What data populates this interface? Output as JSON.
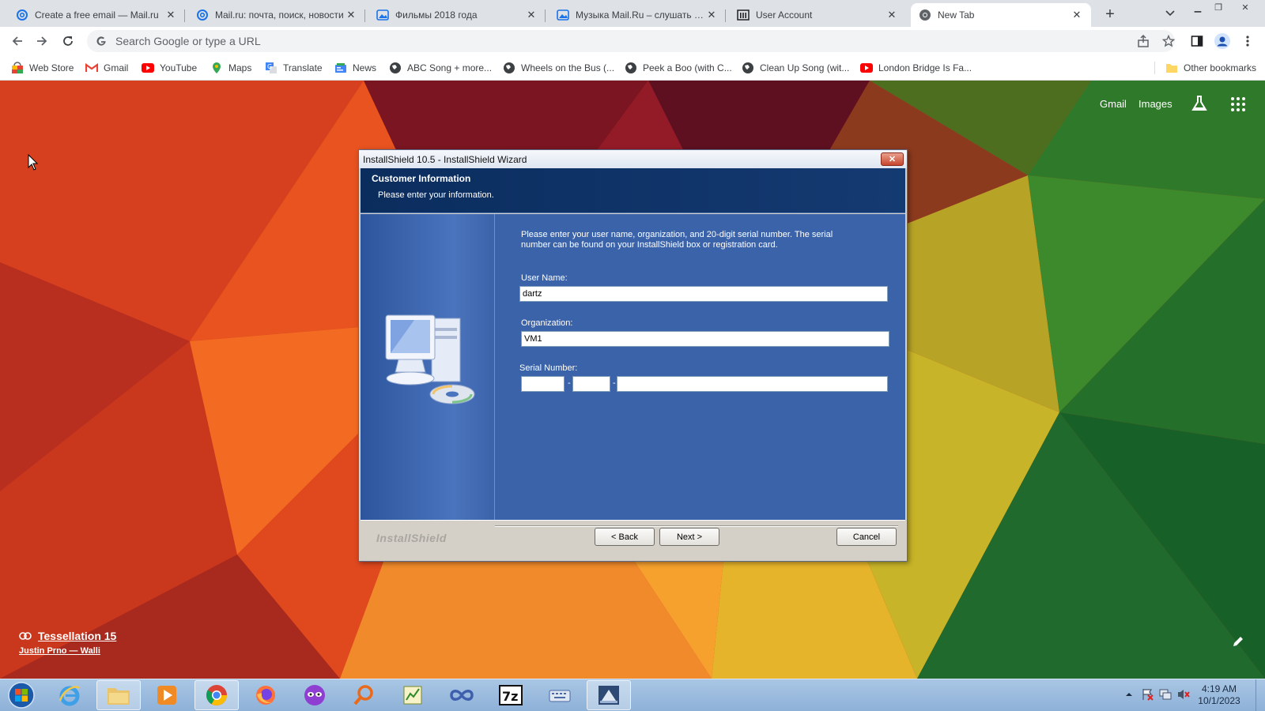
{
  "browser": {
    "tabs": [
      {
        "title": "Create a free email — Mail.ru",
        "icon": "mailru-at-icon",
        "active": false
      },
      {
        "title": "Mail.ru: почта, поиск, новости",
        "icon": "mailru-at-icon",
        "active": false
      },
      {
        "title": "Фильмы 2018 года",
        "icon": "image-icon",
        "active": false
      },
      {
        "title": "Музыка Mail.Ru – слушать лучшее",
        "icon": "image-icon",
        "active": false
      },
      {
        "title": "User Account",
        "icon": "building-icon",
        "active": false
      },
      {
        "title": "New Tab",
        "icon": "chrome-icon",
        "active": true
      }
    ],
    "omnibox": {
      "placeholder": "Search Google or type a URL"
    },
    "bookmarks": [
      {
        "label": "Web Store",
        "icon": "webstore-icon"
      },
      {
        "label": "Gmail",
        "icon": "gmail-icon"
      },
      {
        "label": "YouTube",
        "icon": "youtube-icon"
      },
      {
        "label": "Maps",
        "icon": "maps-icon"
      },
      {
        "label": "Translate",
        "icon": "translate-icon"
      },
      {
        "label": "News",
        "icon": "news-icon"
      },
      {
        "label": "ABC Song + more...",
        "icon": "globe-icon"
      },
      {
        "label": "Wheels on the Bus (...",
        "icon": "globe-icon"
      },
      {
        "label": "Peek a Boo (with C...",
        "icon": "globe-icon"
      },
      {
        "label": "Clean Up Song (wit...",
        "icon": "globe-icon"
      },
      {
        "label": "London Bridge Is Fa...",
        "icon": "youtube-icon"
      }
    ],
    "other_bookmarks": "Other bookmarks"
  },
  "newtab": {
    "gmail_link": "Gmail",
    "images_link": "Images",
    "wallpaper_title": "Tessellation 15",
    "wallpaper_author": "Justin Prno — Walli"
  },
  "dialog": {
    "window_title": "InstallShield 10.5 - InstallShield Wizard",
    "header_title": "Customer Information",
    "header_subtitle": "Please enter your information.",
    "instructions": "Please enter your user name, organization, and 20-digit serial number. The serial number can be found on your InstallShield box or registration card.",
    "username_label": "User Name:",
    "username_value": "dartz",
    "organization_label": "Organization:",
    "organization_value": "VM1",
    "serial_label": "Serial Number:",
    "serial_parts": [
      "",
      "",
      ""
    ],
    "serial_separator": "-",
    "brand": "InstallShield",
    "back_label": "< Back",
    "next_label": "Next >",
    "cancel_label": "Cancel"
  },
  "taskbar": {
    "apps": [
      "start-orb-icon",
      "internet-explorer-icon",
      "file-explorer-icon",
      "media-player-icon",
      "chrome-icon",
      "firefox-icon",
      "mask-app-icon",
      "search-tool-icon",
      "notepad-chart-icon",
      "infinity-app-icon",
      "7zip-icon",
      "keyboard-app-icon",
      "installshield-icon"
    ],
    "clock_time": "4:19 AM",
    "clock_date": "10/1/2023"
  },
  "colors": {
    "dialog_header": "#0b2d5e",
    "dialog_body": "#3b63aa",
    "chrome_tabstrip": "#dee1e6"
  }
}
